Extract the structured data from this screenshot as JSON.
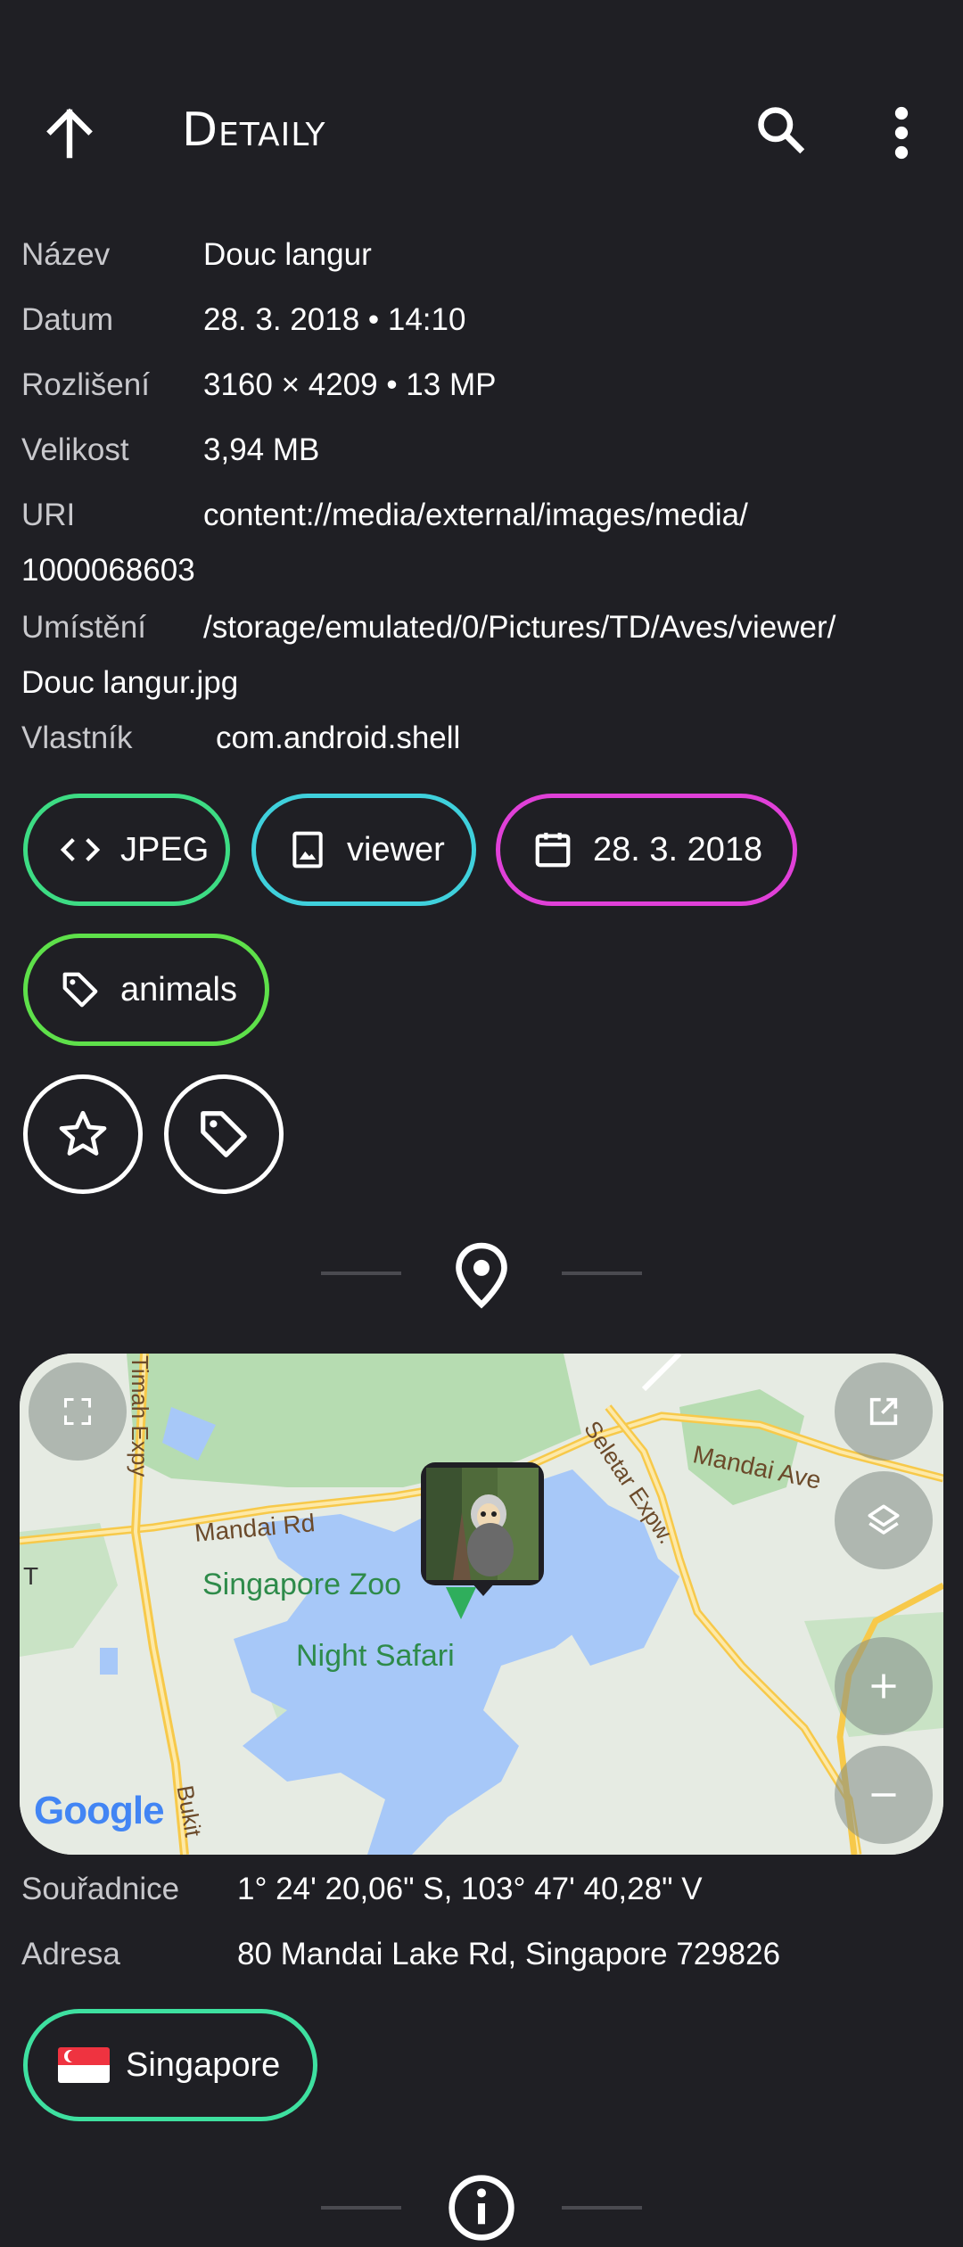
{
  "appbar": {
    "title": "Detaily",
    "back_icon": "arrow-up-icon",
    "search_icon": "search-icon",
    "more_icon": "more-vert-icon"
  },
  "info": {
    "name_key": "Název",
    "name_val": "Douc langur",
    "date_key": "Datum",
    "date_val": "28. 3. 2018 • 14:10",
    "res_key": "Rozlišení",
    "res_val": "3160 × 4209 • 13 MP",
    "size_key": "Velikost",
    "size_val": "3,94 MB",
    "uri_key": "URI",
    "uri_val": "content://media/external/images/media/",
    "uri_val2": "1000068603",
    "path_key": "Umístění",
    "path_val": "/storage/emulated/0/Pictures/TD/Aves/viewer/",
    "path_val2": "Douc langur.jpg",
    "owner_key": "Vlastník",
    "owner_val": "com.android.shell"
  },
  "chips": {
    "format": "JPEG",
    "album": "viewer",
    "date": "28. 3. 2018",
    "tag": "animals",
    "colors": {
      "format": "#3ddc84",
      "album": "#3fd0dc",
      "date": "#e040d8",
      "tag": "#5ee04a"
    }
  },
  "map": {
    "labels": {
      "zoo": "Singapore Zoo",
      "safari": "Night Safari",
      "mandai_rd": "Mandai Rd",
      "mandai_ave": "Mandai Ave",
      "seletar": "Seletar Expw.",
      "timah": "Timah Expy",
      "bukit": "Bukit",
      "t": "T",
      "google": "Google"
    },
    "colors": {
      "land": "#e6ebe3",
      "park": "#b6dcb1",
      "water": "#a7c8f8",
      "road": "#f7c94a"
    }
  },
  "location": {
    "coords_key": "Souřadnice",
    "coords_val": "1° 24' 20,06\" S, 103° 47' 40,28\" V",
    "addr_key": "Adresa",
    "addr_val": "80 Mandai Lake Rd, Singapore 729826",
    "country": "Singapore",
    "country_flag": "🇸🇬",
    "country_color": "#3ee0a0"
  }
}
